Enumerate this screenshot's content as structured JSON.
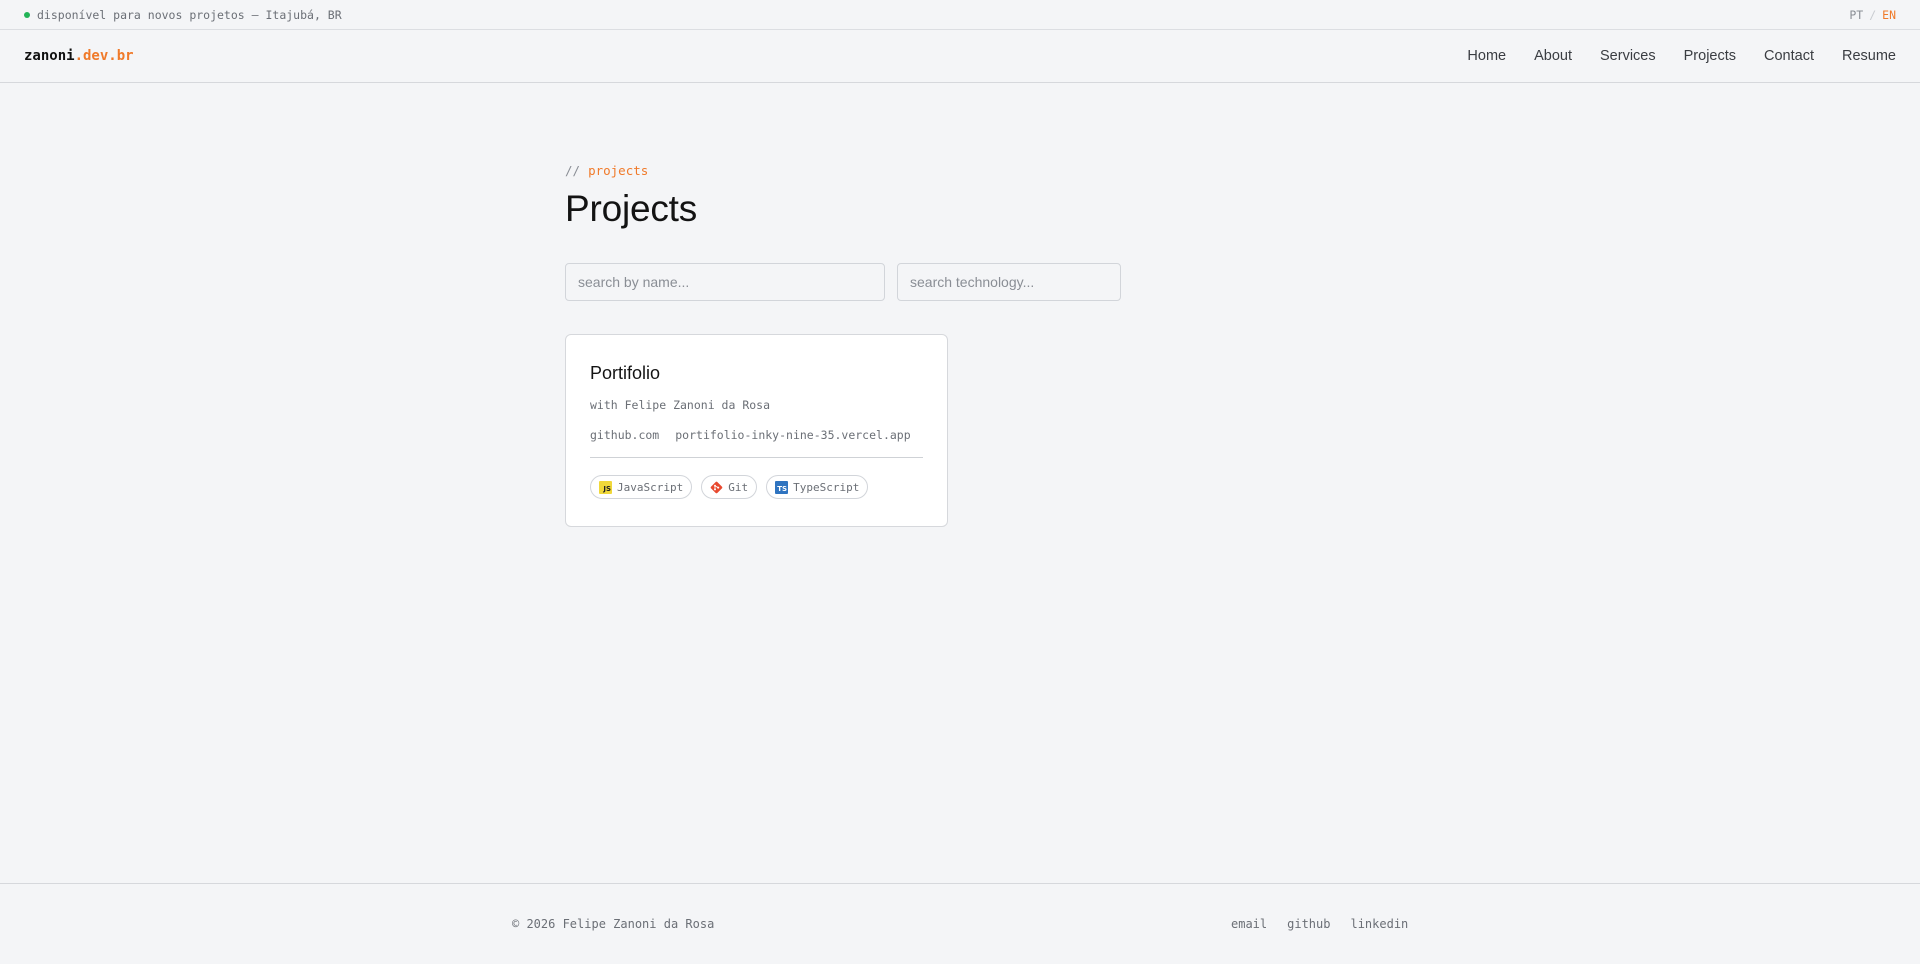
{
  "topbar": {
    "status": "disponível para novos projetos — Itajubá, BR",
    "lang": {
      "pt": "PT",
      "sep": "/",
      "en": "EN"
    }
  },
  "header": {
    "logo_main": "zanoni",
    "logo_accent": ".dev.br",
    "nav": [
      "Home",
      "About",
      "Services",
      "Projects",
      "Contact",
      "Resume"
    ]
  },
  "main": {
    "eyebrow_prefix": "//",
    "eyebrow": "projects",
    "title": "Projects",
    "search_name_placeholder": "search by name...",
    "search_tech_placeholder": "search technology..."
  },
  "projects": [
    {
      "title": "Portifolio",
      "subtitle": "with Felipe Zanoni da Rosa",
      "links": [
        "github.com",
        "portifolio-inky-nine-35.vercel.app"
      ],
      "tags": [
        {
          "label": "JavaScript",
          "icon": "javascript-icon"
        },
        {
          "label": "Git",
          "icon": "git-icon"
        },
        {
          "label": "TypeScript",
          "icon": "typescript-icon"
        }
      ]
    }
  ],
  "footer": {
    "copyright": "© 2026 Felipe Zanoni da Rosa",
    "links": [
      "email",
      "github",
      "linkedin"
    ]
  },
  "colors": {
    "accent": "#f07a2a",
    "status_dot": "#22b357",
    "background": "#f4f5f7"
  }
}
